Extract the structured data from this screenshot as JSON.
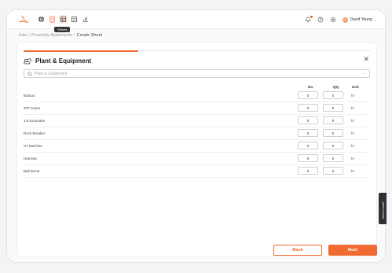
{
  "topbar": {
    "nav_icons": [
      "globe-icon",
      "document-icon",
      "sheets-icon",
      "checklist-icon",
      "chart-icon"
    ],
    "active_nav": "sheets-icon",
    "tooltip": "Sheets",
    "tools": [
      "bell-icon",
      "help-icon",
      "settings-icon"
    ],
    "user": {
      "initials": "DY",
      "name": "David Young"
    }
  },
  "breadcrumb": {
    "items": [
      "Jobs",
      "Proximity Apartments"
    ],
    "current": "Create Sheet"
  },
  "progress_percent": 33,
  "section": {
    "title": "Plant & Equipment",
    "search_placeholder": "Plant & Equipment"
  },
  "columns": {
    "no": "No.",
    "qty": "Qty",
    "unit": "Unit"
  },
  "equipment": [
    {
      "name": "Bobcat",
      "no": "0",
      "qty": "0",
      "unit": "hr"
    },
    {
      "name": "20T Crane",
      "no": "0",
      "qty": "0",
      "unit": "hr"
    },
    {
      "name": "1.8 Excavator",
      "no": "0",
      "qty": "0",
      "unit": "hr"
    },
    {
      "name": "Rock Breaker",
      "no": "0",
      "qty": "0",
      "unit": "hr"
    },
    {
      "name": "ST Machine",
      "no": "0",
      "qty": "0",
      "unit": "hr"
    },
    {
      "name": "Harrows",
      "no": "0",
      "qty": "0",
      "unit": "hr"
    },
    {
      "name": "Bull Dozer",
      "no": "0",
      "qty": "0",
      "unit": "hr"
    }
  ],
  "buttons": {
    "back": "Back",
    "next": "Next"
  },
  "help_tab": "Need a hand?",
  "colors": {
    "accent": "#f06a32",
    "help_tab": "#2e2e34"
  }
}
